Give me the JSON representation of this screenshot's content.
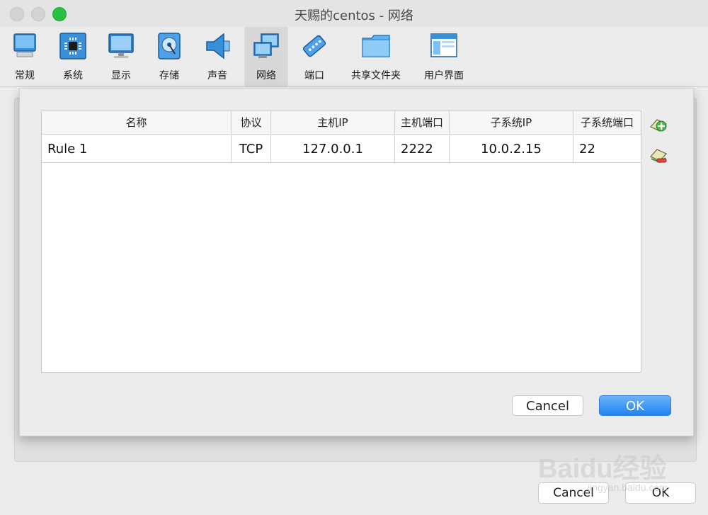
{
  "window": {
    "title": "天赐的centos - 网络"
  },
  "toolbar": {
    "items": [
      {
        "label": "常规",
        "icon": "general-icon"
      },
      {
        "label": "系统",
        "icon": "system-icon"
      },
      {
        "label": "显示",
        "icon": "display-icon"
      },
      {
        "label": "存储",
        "icon": "storage-icon"
      },
      {
        "label": "声音",
        "icon": "audio-icon"
      },
      {
        "label": "网络",
        "icon": "network-icon",
        "selected": true
      },
      {
        "label": "端口",
        "icon": "ports-icon"
      },
      {
        "label": "共享文件夹",
        "icon": "shared-folders-icon"
      },
      {
        "label": "用户界面",
        "icon": "user-interface-icon"
      }
    ]
  },
  "port_forwarding": {
    "columns": [
      "名称",
      "协议",
      "主机IP",
      "主机端口",
      "子系统IP",
      "子系统端口"
    ],
    "rows": [
      {
        "name": "Rule 1",
        "protocol": "TCP",
        "host_ip": "127.0.0.1",
        "host_port": "2222",
        "guest_ip": "10.0.2.15",
        "guest_port": "22"
      }
    ],
    "add_rule_icon": "add-rule-icon",
    "remove_rule_icon": "remove-rule-icon"
  },
  "dialog": {
    "cancel_label": "Cancel",
    "ok_label": "OK"
  },
  "background_dialog": {
    "cancel_label": "Cancel",
    "ok_label": "OK"
  },
  "watermark": {
    "text": "Baidu经验",
    "url": "jingyan.baidu.com"
  },
  "colors": {
    "ok_button": "#1f83f0",
    "zoom_light": "#29c041"
  }
}
